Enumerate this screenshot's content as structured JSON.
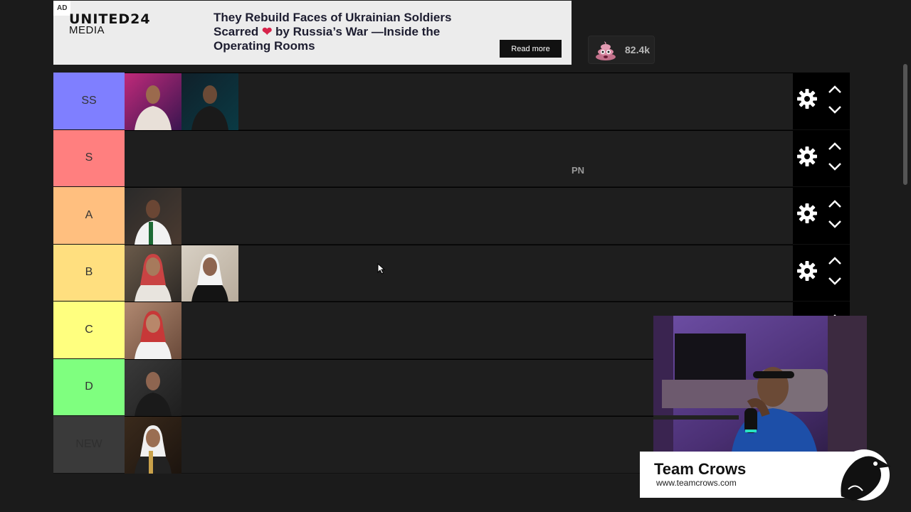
{
  "ad": {
    "badge": "AD",
    "brand_line1": "UNITED24",
    "brand_line2": "MEDIA",
    "headline_part1": "They Rebuild Faces of Ukrainian Soldiers Scarred",
    "headline_part2": "by Russia’s War —Inside the Operating Rooms",
    "cta": "Read more"
  },
  "reaction": {
    "icon": "poop-emoji-icon",
    "count": "82.4k"
  },
  "tiers": [
    {
      "label": "SS",
      "color": "#7f7fff",
      "items": [
        "person-neon-club",
        "person-dark-club"
      ]
    },
    {
      "label": "S",
      "color": "#ff7f7f",
      "items": []
    },
    {
      "label": "A",
      "color": "#ffbf7f",
      "items": [
        "person-green-scarf"
      ]
    },
    {
      "label": "B",
      "color": "#ffdf7f",
      "items": [
        "person-red-shemagh",
        "person-black-bisht"
      ]
    },
    {
      "label": "C",
      "color": "#ffff7f",
      "items": [
        "person-red-ghutra"
      ]
    },
    {
      "label": "D",
      "color": "#7fff7f",
      "items": [
        "person-black-thobe"
      ]
    },
    {
      "label": "NEW",
      "color": "#3a3a3a",
      "items": [
        "person-trophy"
      ]
    }
  ],
  "floating_text": "PN",
  "overlay": {
    "brand_title": "Team Crows",
    "brand_url": "www.teamcrows.com"
  }
}
